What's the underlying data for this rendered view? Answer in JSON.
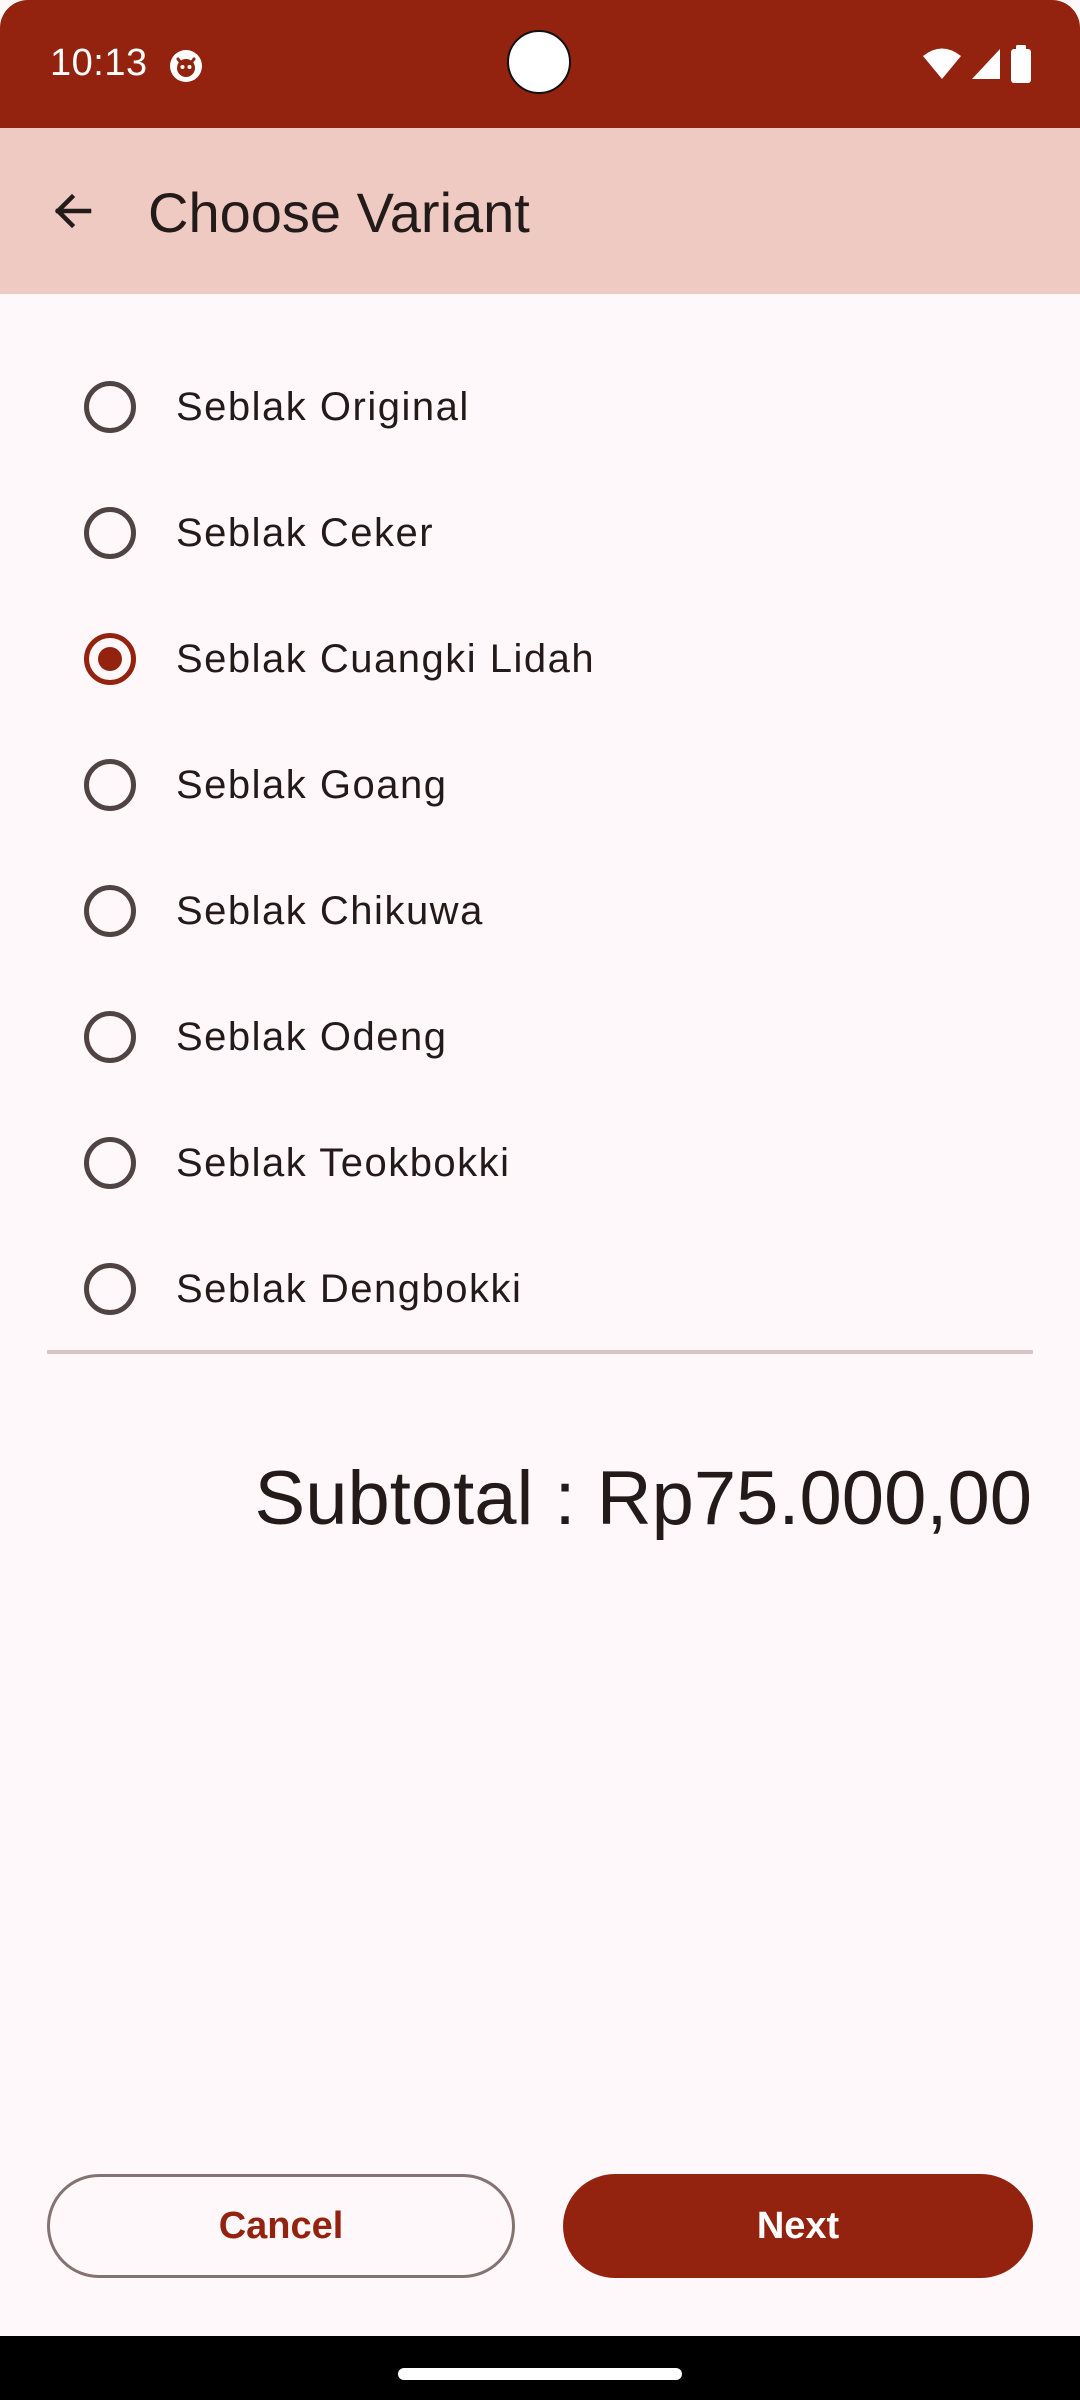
{
  "status_bar": {
    "time": "10:13",
    "icons": [
      "app-notification-icon",
      "wifi-icon",
      "signal-icon",
      "battery-icon"
    ],
    "background": "#93230f"
  },
  "app_bar": {
    "title": "Choose Variant",
    "back_icon": "arrow-back-icon",
    "background": "#efcac2"
  },
  "variants": [
    {
      "label": "Seblak Original",
      "selected": false
    },
    {
      "label": "Seblak Ceker",
      "selected": false
    },
    {
      "label": "Seblak Cuangki Lidah",
      "selected": true
    },
    {
      "label": "Seblak Goang",
      "selected": false
    },
    {
      "label": "Seblak Chikuwa",
      "selected": false
    },
    {
      "label": "Seblak Odeng",
      "selected": false
    },
    {
      "label": "Seblak Teokbokki",
      "selected": false
    },
    {
      "label": "Seblak Dengbokki",
      "selected": false
    }
  ],
  "subtotal_text": "Subtotal : Rp75.000,00",
  "actions": {
    "cancel_label": "Cancel",
    "next_label": "Next"
  },
  "colors": {
    "accent": "#93230f",
    "surface": "#fff8fb"
  }
}
